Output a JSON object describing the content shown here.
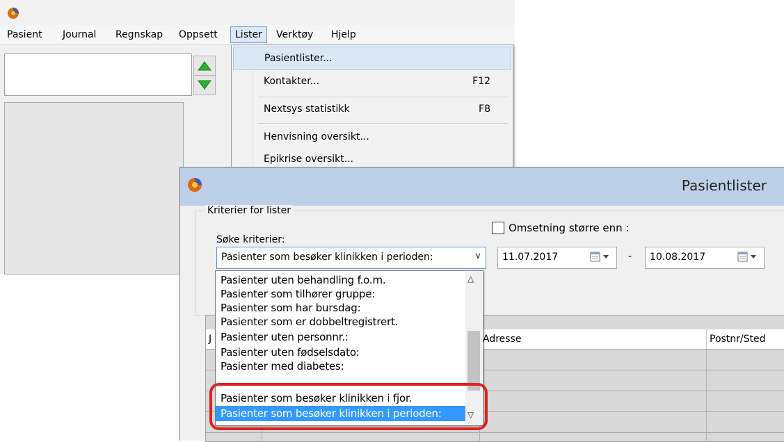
{
  "menubar": {
    "items": [
      "Pasient",
      "Journal",
      "Regnskap",
      "Oppsett",
      "Lister",
      "Verktøy",
      "Hjelp"
    ]
  },
  "lister_menu": {
    "items": [
      {
        "label": "Pasientlister...",
        "shortcut": ""
      },
      {
        "label": "Kontakter...",
        "shortcut": "F12"
      },
      {
        "label": "Nextsys statistikk",
        "shortcut": "F8"
      },
      {
        "label": "Henvisning oversikt...",
        "shortcut": ""
      },
      {
        "label": "Epikrise oversikt...",
        "shortcut": ""
      }
    ]
  },
  "dialog": {
    "title": "Pasientlister",
    "group_label": "Kriterier for lister",
    "soke_label": "Søke kriterier:",
    "combo_value": "Pasienter som besøker klinikken i perioden:",
    "omsetning_label": "Omsetning større enn :",
    "date_from": "11.07.2017",
    "date_to": "10.08.2017",
    "date_separator": "-"
  },
  "dropdown_options": [
    "Pasienter uten behandling f.o.m.",
    "Pasienter som tilhører gruppe:",
    "Pasienter som har bursdag:",
    "Pasienter som er dobbeltregistrert.",
    "Pasienter uten personnr.:",
    "Pasienter uten fødselsdato:",
    "Pasienter med diabetes:",
    "Pasienter som besøker klinikken i fjor.",
    "Pasienter som besøker klinikken i perioden:"
  ],
  "table": {
    "headers": [
      "J",
      "Adresse",
      "Postnr/Sted"
    ]
  },
  "colors": {
    "highlight_ring": "#e02020",
    "selected_option": "#3399ff",
    "arrow_green": "#2eae2e"
  }
}
